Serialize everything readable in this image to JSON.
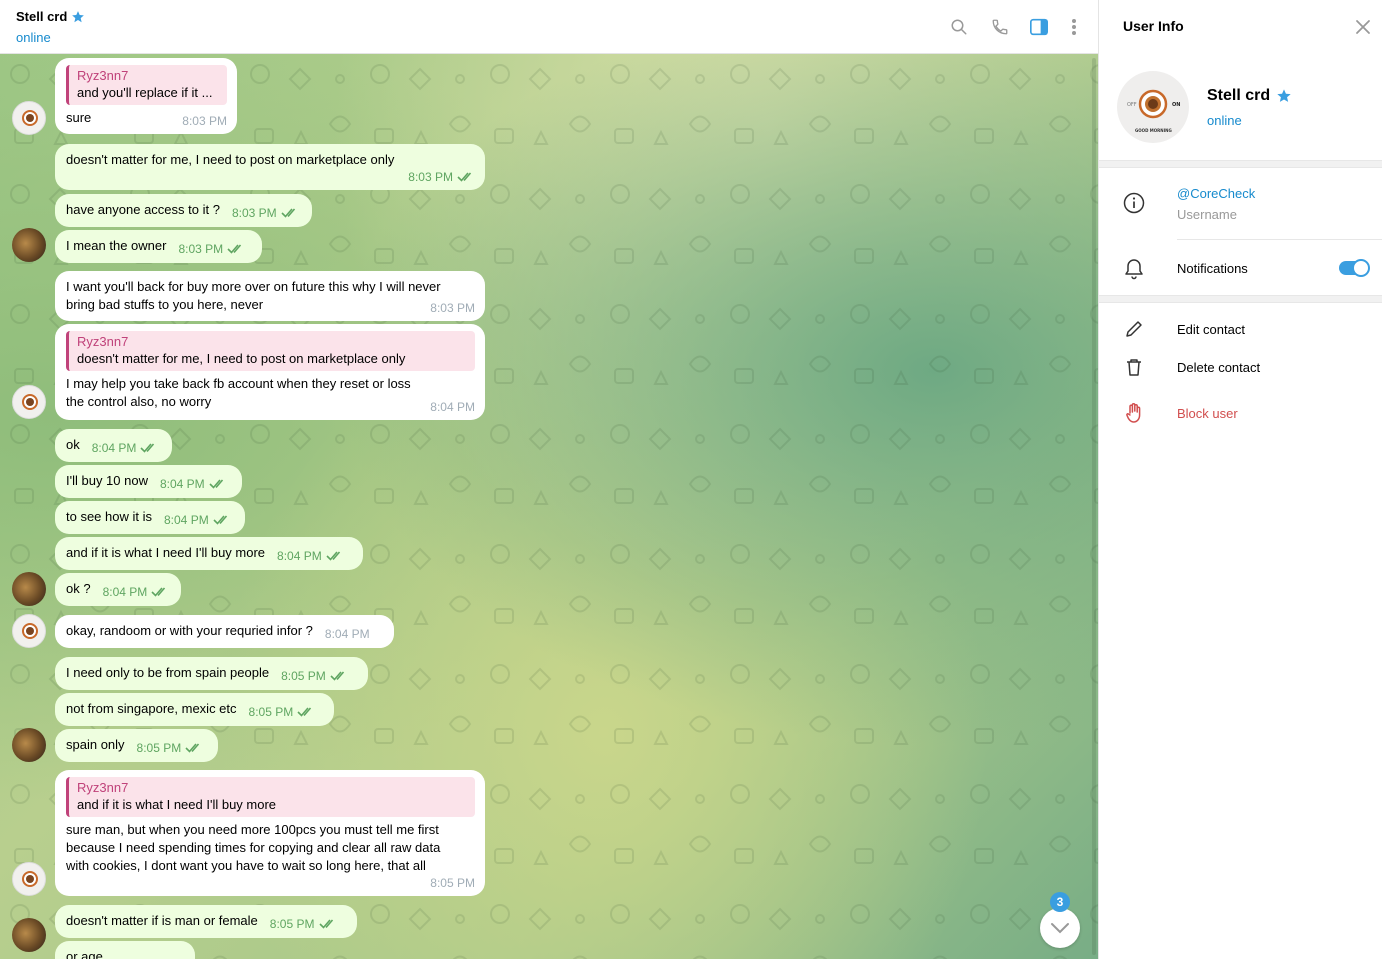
{
  "header": {
    "title": "Stell crd",
    "status": "online"
  },
  "messages": [
    {
      "dir": "in",
      "reply_name": "Ryz3nn7",
      "reply_text": "and you'll replace if it ...",
      "text": "sure",
      "time": "8:03 PM"
    },
    {
      "dir": "out",
      "text": "doesn't matter for me, I need to post on marketplace only",
      "time": "8:03 PM"
    },
    {
      "dir": "out",
      "text": "have anyone access to it ?",
      "time": "8:03 PM"
    },
    {
      "dir": "out",
      "text": "I mean the owner",
      "time": "8:03 PM"
    },
    {
      "dir": "in",
      "text": "I want you'll back for buy more over on future this why I will never bring bad stuffs to you here, never",
      "time": "8:03 PM"
    },
    {
      "dir": "in",
      "reply_name": "Ryz3nn7",
      "reply_text": "doesn't matter for me, I need to post on marketplace only",
      "text": "I may help you take back fb account when they reset or loss the control also, no worry",
      "time": "8:04 PM"
    },
    {
      "dir": "out",
      "text": "ok",
      "time": "8:04 PM"
    },
    {
      "dir": "out",
      "text": "I'll buy 10 now",
      "time": "8:04 PM"
    },
    {
      "dir": "out",
      "text": "to see how it is",
      "time": "8:04 PM"
    },
    {
      "dir": "out",
      "text": "and if it is what I need I'll buy more",
      "time": "8:04 PM"
    },
    {
      "dir": "out",
      "text": "ok ?",
      "time": "8:04 PM"
    },
    {
      "dir": "in",
      "text": "okay, randoom or with your requried infor ?",
      "time": "8:04 PM"
    },
    {
      "dir": "out",
      "text": "I need only to be from spain people",
      "time": "8:05 PM"
    },
    {
      "dir": "out",
      "text": "not from singapore, mexic etc",
      "time": "8:05 PM"
    },
    {
      "dir": "out",
      "text": "spain only",
      "time": "8:05 PM"
    },
    {
      "dir": "in",
      "reply_name": "Ryz3nn7",
      "reply_text": "and if it is what I need I'll buy more",
      "text": "sure man, but when you need more 100pcs you must tell me first because I need spending times for copying and clear all raw data with cookies, I dont want you have to wait so long here, that all",
      "time": "8:05 PM"
    },
    {
      "dir": "out",
      "text": "doesn't matter if is man or female",
      "time": "8:05 PM"
    },
    {
      "dir": "out",
      "text": "or age",
      "time": ""
    }
  ],
  "unread_count": "3",
  "side_panel": {
    "title": "User Info",
    "name": "Stell crd",
    "status": "online",
    "username_value": "@CoreCheck",
    "username_label": "Username",
    "notifications_label": "Notifications",
    "notifications_on": true,
    "edit_contact": "Edit contact",
    "delete_contact": "Delete contact",
    "block_user": "Block user"
  },
  "colors": {
    "accent": "#168acd",
    "out_bubble": "#eefedf",
    "in_bubble": "#ffffff",
    "out_time": "#5fa561",
    "reply_accent": "#c0427a",
    "danger": "#d14e4e"
  },
  "icons": [
    "search-icon",
    "phone-icon",
    "sidebar-toggle-icon",
    "more-vert-icon",
    "close-icon",
    "info-icon",
    "bell-icon",
    "pencil-icon",
    "trash-icon",
    "hand-block-icon",
    "chevron-down-icon",
    "star-icon",
    "double-check-icon"
  ]
}
